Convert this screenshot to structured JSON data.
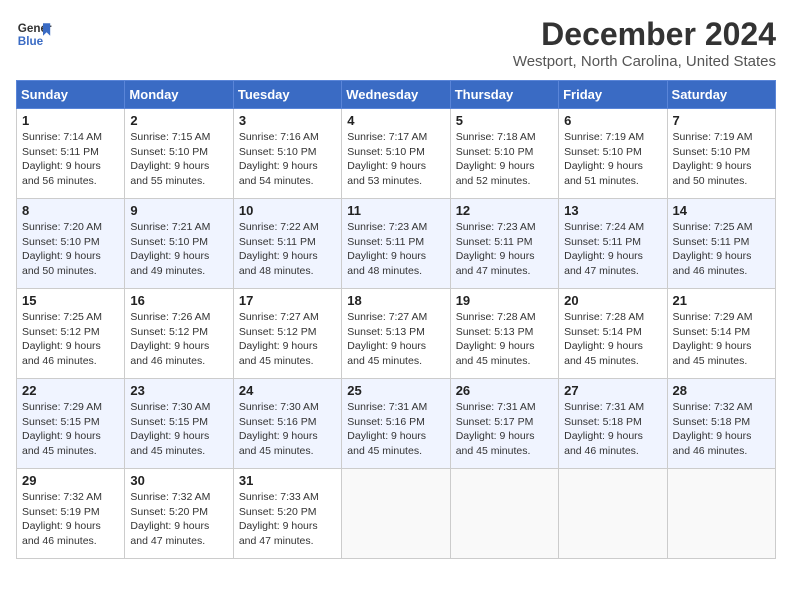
{
  "header": {
    "logo_line1": "General",
    "logo_line2": "Blue",
    "month_title": "December 2024",
    "location": "Westport, North Carolina, United States"
  },
  "weekdays": [
    "Sunday",
    "Monday",
    "Tuesday",
    "Wednesday",
    "Thursday",
    "Friday",
    "Saturday"
  ],
  "weeks": [
    [
      {
        "day": "1",
        "sunrise": "Sunrise: 7:14 AM",
        "sunset": "Sunset: 5:11 PM",
        "daylight": "Daylight: 9 hours and 56 minutes."
      },
      {
        "day": "2",
        "sunrise": "Sunrise: 7:15 AM",
        "sunset": "Sunset: 5:10 PM",
        "daylight": "Daylight: 9 hours and 55 minutes."
      },
      {
        "day": "3",
        "sunrise": "Sunrise: 7:16 AM",
        "sunset": "Sunset: 5:10 PM",
        "daylight": "Daylight: 9 hours and 54 minutes."
      },
      {
        "day": "4",
        "sunrise": "Sunrise: 7:17 AM",
        "sunset": "Sunset: 5:10 PM",
        "daylight": "Daylight: 9 hours and 53 minutes."
      },
      {
        "day": "5",
        "sunrise": "Sunrise: 7:18 AM",
        "sunset": "Sunset: 5:10 PM",
        "daylight": "Daylight: 9 hours and 52 minutes."
      },
      {
        "day": "6",
        "sunrise": "Sunrise: 7:19 AM",
        "sunset": "Sunset: 5:10 PM",
        "daylight": "Daylight: 9 hours and 51 minutes."
      },
      {
        "day": "7",
        "sunrise": "Sunrise: 7:19 AM",
        "sunset": "Sunset: 5:10 PM",
        "daylight": "Daylight: 9 hours and 50 minutes."
      }
    ],
    [
      {
        "day": "8",
        "sunrise": "Sunrise: 7:20 AM",
        "sunset": "Sunset: 5:10 PM",
        "daylight": "Daylight: 9 hours and 50 minutes."
      },
      {
        "day": "9",
        "sunrise": "Sunrise: 7:21 AM",
        "sunset": "Sunset: 5:10 PM",
        "daylight": "Daylight: 9 hours and 49 minutes."
      },
      {
        "day": "10",
        "sunrise": "Sunrise: 7:22 AM",
        "sunset": "Sunset: 5:11 PM",
        "daylight": "Daylight: 9 hours and 48 minutes."
      },
      {
        "day": "11",
        "sunrise": "Sunrise: 7:23 AM",
        "sunset": "Sunset: 5:11 PM",
        "daylight": "Daylight: 9 hours and 48 minutes."
      },
      {
        "day": "12",
        "sunrise": "Sunrise: 7:23 AM",
        "sunset": "Sunset: 5:11 PM",
        "daylight": "Daylight: 9 hours and 47 minutes."
      },
      {
        "day": "13",
        "sunrise": "Sunrise: 7:24 AM",
        "sunset": "Sunset: 5:11 PM",
        "daylight": "Daylight: 9 hours and 47 minutes."
      },
      {
        "day": "14",
        "sunrise": "Sunrise: 7:25 AM",
        "sunset": "Sunset: 5:11 PM",
        "daylight": "Daylight: 9 hours and 46 minutes."
      }
    ],
    [
      {
        "day": "15",
        "sunrise": "Sunrise: 7:25 AM",
        "sunset": "Sunset: 5:12 PM",
        "daylight": "Daylight: 9 hours and 46 minutes."
      },
      {
        "day": "16",
        "sunrise": "Sunrise: 7:26 AM",
        "sunset": "Sunset: 5:12 PM",
        "daylight": "Daylight: 9 hours and 46 minutes."
      },
      {
        "day": "17",
        "sunrise": "Sunrise: 7:27 AM",
        "sunset": "Sunset: 5:12 PM",
        "daylight": "Daylight: 9 hours and 45 minutes."
      },
      {
        "day": "18",
        "sunrise": "Sunrise: 7:27 AM",
        "sunset": "Sunset: 5:13 PM",
        "daylight": "Daylight: 9 hours and 45 minutes."
      },
      {
        "day": "19",
        "sunrise": "Sunrise: 7:28 AM",
        "sunset": "Sunset: 5:13 PM",
        "daylight": "Daylight: 9 hours and 45 minutes."
      },
      {
        "day": "20",
        "sunrise": "Sunrise: 7:28 AM",
        "sunset": "Sunset: 5:14 PM",
        "daylight": "Daylight: 9 hours and 45 minutes."
      },
      {
        "day": "21",
        "sunrise": "Sunrise: 7:29 AM",
        "sunset": "Sunset: 5:14 PM",
        "daylight": "Daylight: 9 hours and 45 minutes."
      }
    ],
    [
      {
        "day": "22",
        "sunrise": "Sunrise: 7:29 AM",
        "sunset": "Sunset: 5:15 PM",
        "daylight": "Daylight: 9 hours and 45 minutes."
      },
      {
        "day": "23",
        "sunrise": "Sunrise: 7:30 AM",
        "sunset": "Sunset: 5:15 PM",
        "daylight": "Daylight: 9 hours and 45 minutes."
      },
      {
        "day": "24",
        "sunrise": "Sunrise: 7:30 AM",
        "sunset": "Sunset: 5:16 PM",
        "daylight": "Daylight: 9 hours and 45 minutes."
      },
      {
        "day": "25",
        "sunrise": "Sunrise: 7:31 AM",
        "sunset": "Sunset: 5:16 PM",
        "daylight": "Daylight: 9 hours and 45 minutes."
      },
      {
        "day": "26",
        "sunrise": "Sunrise: 7:31 AM",
        "sunset": "Sunset: 5:17 PM",
        "daylight": "Daylight: 9 hours and 45 minutes."
      },
      {
        "day": "27",
        "sunrise": "Sunrise: 7:31 AM",
        "sunset": "Sunset: 5:18 PM",
        "daylight": "Daylight: 9 hours and 46 minutes."
      },
      {
        "day": "28",
        "sunrise": "Sunrise: 7:32 AM",
        "sunset": "Sunset: 5:18 PM",
        "daylight": "Daylight: 9 hours and 46 minutes."
      }
    ],
    [
      {
        "day": "29",
        "sunrise": "Sunrise: 7:32 AM",
        "sunset": "Sunset: 5:19 PM",
        "daylight": "Daylight: 9 hours and 46 minutes."
      },
      {
        "day": "30",
        "sunrise": "Sunrise: 7:32 AM",
        "sunset": "Sunset: 5:20 PM",
        "daylight": "Daylight: 9 hours and 47 minutes."
      },
      {
        "day": "31",
        "sunrise": "Sunrise: 7:33 AM",
        "sunset": "Sunset: 5:20 PM",
        "daylight": "Daylight: 9 hours and 47 minutes."
      },
      null,
      null,
      null,
      null
    ]
  ]
}
